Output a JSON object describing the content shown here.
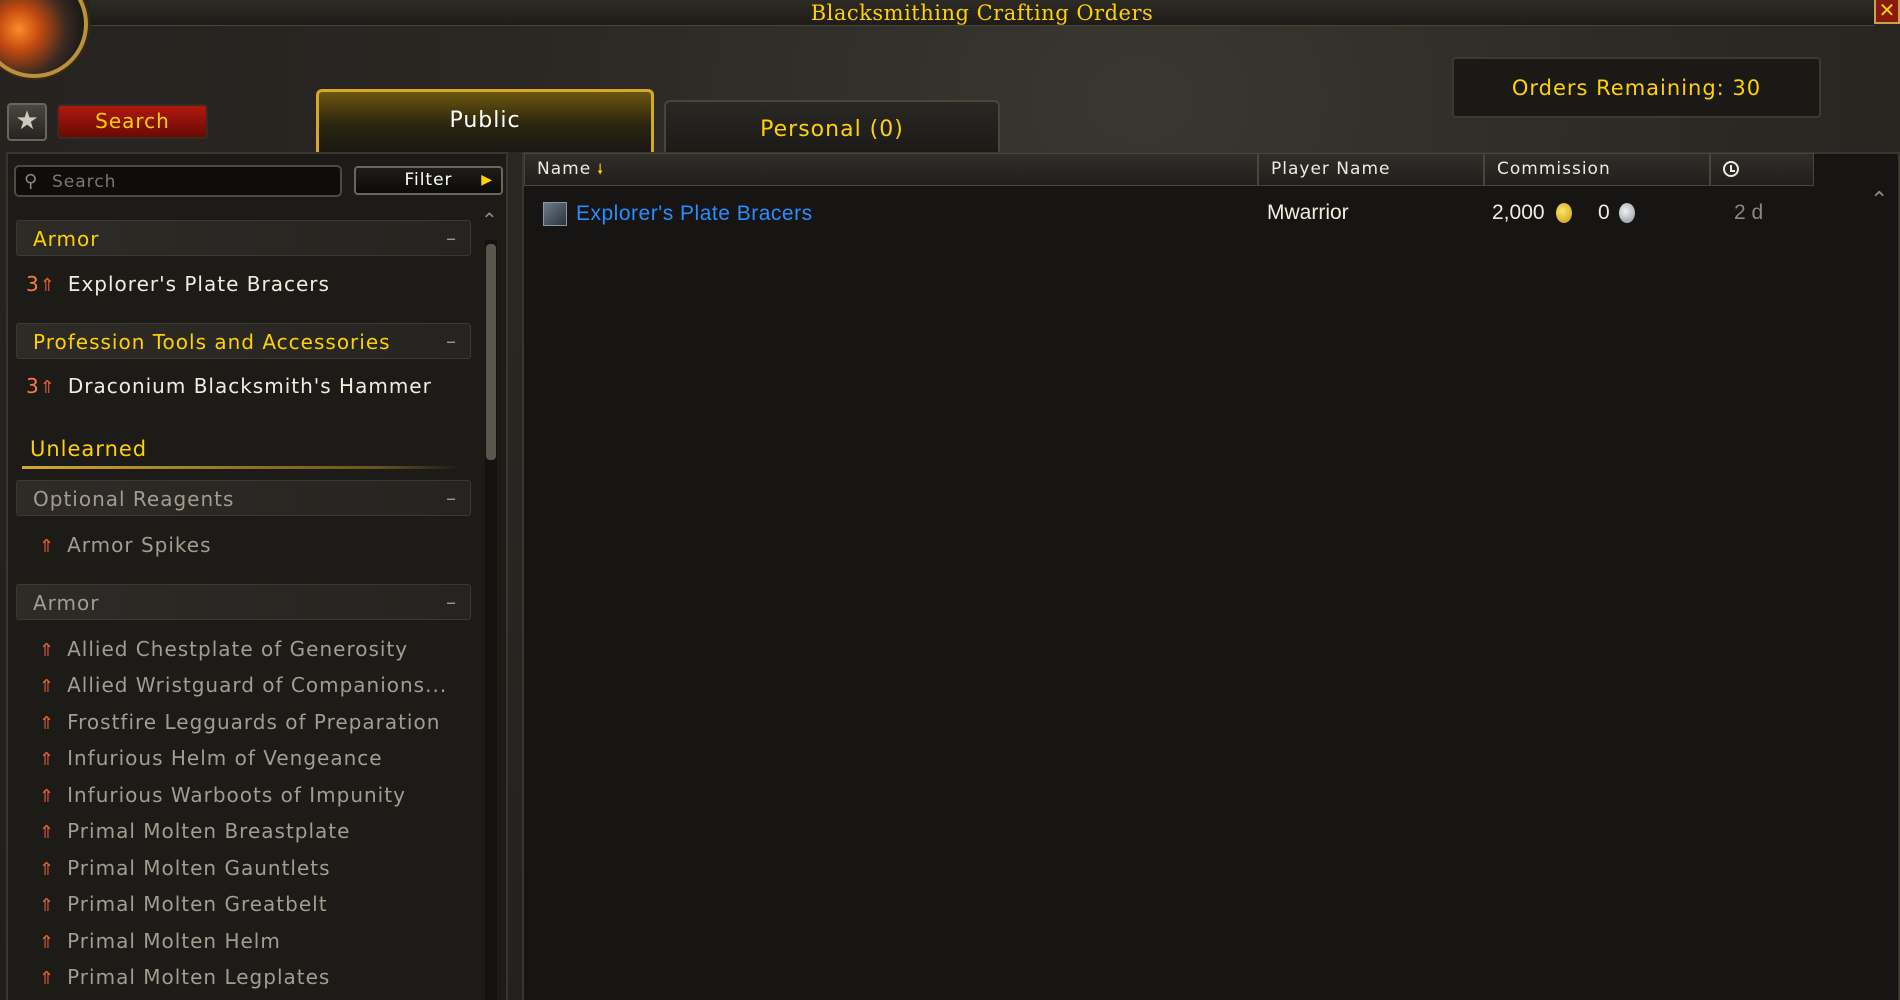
{
  "window": {
    "title": "Blacksmithing Crafting Orders",
    "close_label": "✕"
  },
  "orders_remaining": "Orders Remaining: 30",
  "toolbar": {
    "search_label": "Search",
    "fav_icon": "star-icon"
  },
  "tabs": [
    {
      "label": "Public",
      "active": true
    },
    {
      "label": "Personal (0)",
      "active": false
    }
  ],
  "sidebar": {
    "search_placeholder": "Search",
    "filter_label": "Filter",
    "categories": [
      {
        "label": "Armor",
        "items": [
          {
            "rank": "3",
            "name": "Explorer's Plate Bracers"
          }
        ]
      },
      {
        "label": "Profession Tools and Accessories",
        "items": [
          {
            "rank": "3",
            "name": "Draconium Blacksmith's Hammer"
          }
        ]
      }
    ],
    "unlearned_label": "Unlearned",
    "unlearned_categories": [
      {
        "label": "Optional Reagents",
        "items": [
          "Armor Spikes"
        ]
      },
      {
        "label": "Armor",
        "items": [
          "Allied Chestplate of Generosity",
          "Allied Wristguard of Companions...",
          "Frostfire Legguards of Preparation",
          "Infurious Helm of Vengeance",
          "Infurious Warboots of Impunity",
          "Primal Molten Breastplate",
          "Primal Molten Gauntlets",
          "Primal Molten Greatbelt",
          "Primal Molten Helm",
          "Primal Molten Legplates"
        ]
      }
    ]
  },
  "table": {
    "columns": [
      "Name",
      "Player Name",
      "Commission",
      ""
    ],
    "rows": [
      {
        "name": "Explorer's Plate Bracers",
        "player": "Mwarrior",
        "gold": "2,000",
        "silver": "0",
        "time": "2 d"
      }
    ]
  },
  "colors": {
    "gold_text": "#ffd100",
    "link_blue": "#2a8cff",
    "danger_red": "#b0180e"
  }
}
